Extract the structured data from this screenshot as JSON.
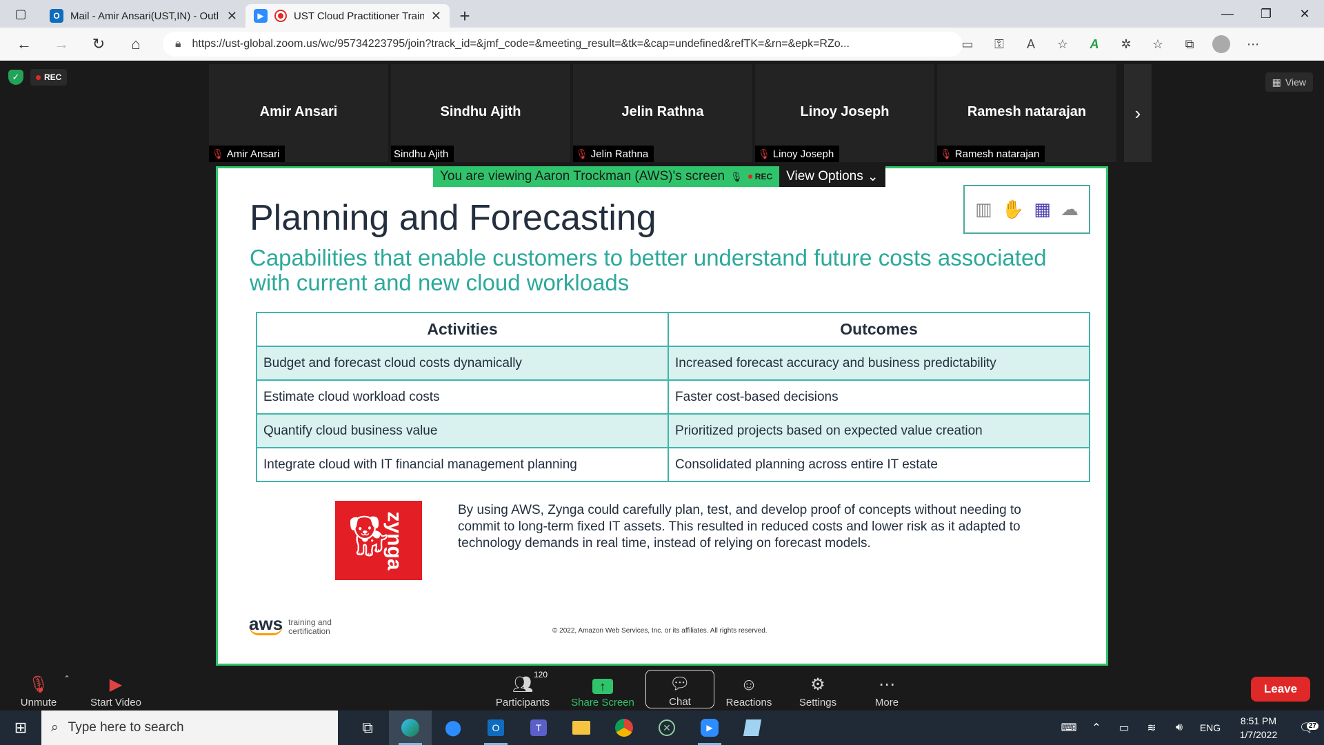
{
  "browser": {
    "tabs": [
      {
        "title": "Mail - Amir Ansari(UST,IN) - Outl",
        "favicon": "outlook-icon",
        "color": "#0f6cbd"
      },
      {
        "title": "UST Cloud Practitioner Train",
        "favicon": "zoom-icon",
        "color": "#2d8cff"
      }
    ],
    "url": "https://ust-global.zoom.us/wc/95734223795/join?track_id=&jmf_code=&meeting_result=&tk=&cap=undefined&refTK=&rn=&epk=RZo..."
  },
  "meeting": {
    "rec_label": "REC",
    "view_label": "View",
    "participants": [
      {
        "display": "Amir Ansari",
        "tag": "Amir Ansari",
        "muted": true
      },
      {
        "display": "Sindhu Ajith",
        "tag": "Sindhu Ajith",
        "muted": false
      },
      {
        "display": "Jelin Rathna",
        "tag": "Jelin Rathna",
        "muted": true
      },
      {
        "display": "Linoy Joseph",
        "tag": "Linoy Joseph",
        "muted": true
      },
      {
        "display": "Ramesh natarajan",
        "tag": "Ramesh natarajan",
        "muted": true
      }
    ],
    "viewing_banner": "You are viewing Aaron Trockman (AWS)'s screen",
    "view_options": "View Options"
  },
  "slide": {
    "title": "Planning and Forecasting",
    "subtitle": "Capabilities that  enable customers to better understand future costs associated with current and new cloud workloads",
    "table": {
      "headers": [
        "Activities",
        "Outcomes"
      ],
      "rows": [
        [
          "Budget and forecast cloud costs dynamically",
          "Increased forecast accuracy and business predictability"
        ],
        [
          "Estimate cloud workload costs",
          "Faster cost-based decisions"
        ],
        [
          "Quantify cloud business value",
          "Prioritized projects based on expected value creation"
        ],
        [
          "Integrate cloud with IT financial management planning",
          "Consolidated planning across entire IT estate"
        ]
      ]
    },
    "zynga_logo_text": "zynga",
    "zynga_text": "By using AWS, Zynga could carefully plan, test, and develop proof of concepts without needing to commit to long-term fixed IT assets. This resulted in reduced costs and lower risk as it adapted to technology demands in real time, instead of relying on forecast models.",
    "aws_logo": "aws",
    "aws_tagline_1": "training and",
    "aws_tagline_2": "certification",
    "copyright": "© 2022, Amazon Web Services, Inc. or its affiliates. All rights reserved."
  },
  "toolbar": {
    "unmute": "Unmute",
    "start_video": "Start Video",
    "participants": "Participants",
    "participants_count": "120",
    "share_screen": "Share Screen",
    "chat": "Chat",
    "reactions": "Reactions",
    "settings": "Settings",
    "more": "More",
    "leave": "Leave"
  },
  "taskbar": {
    "search_placeholder": "Type here to search",
    "language": "ENG",
    "time": "8:51 PM",
    "date": "1/7/2022",
    "notifications": "27"
  }
}
